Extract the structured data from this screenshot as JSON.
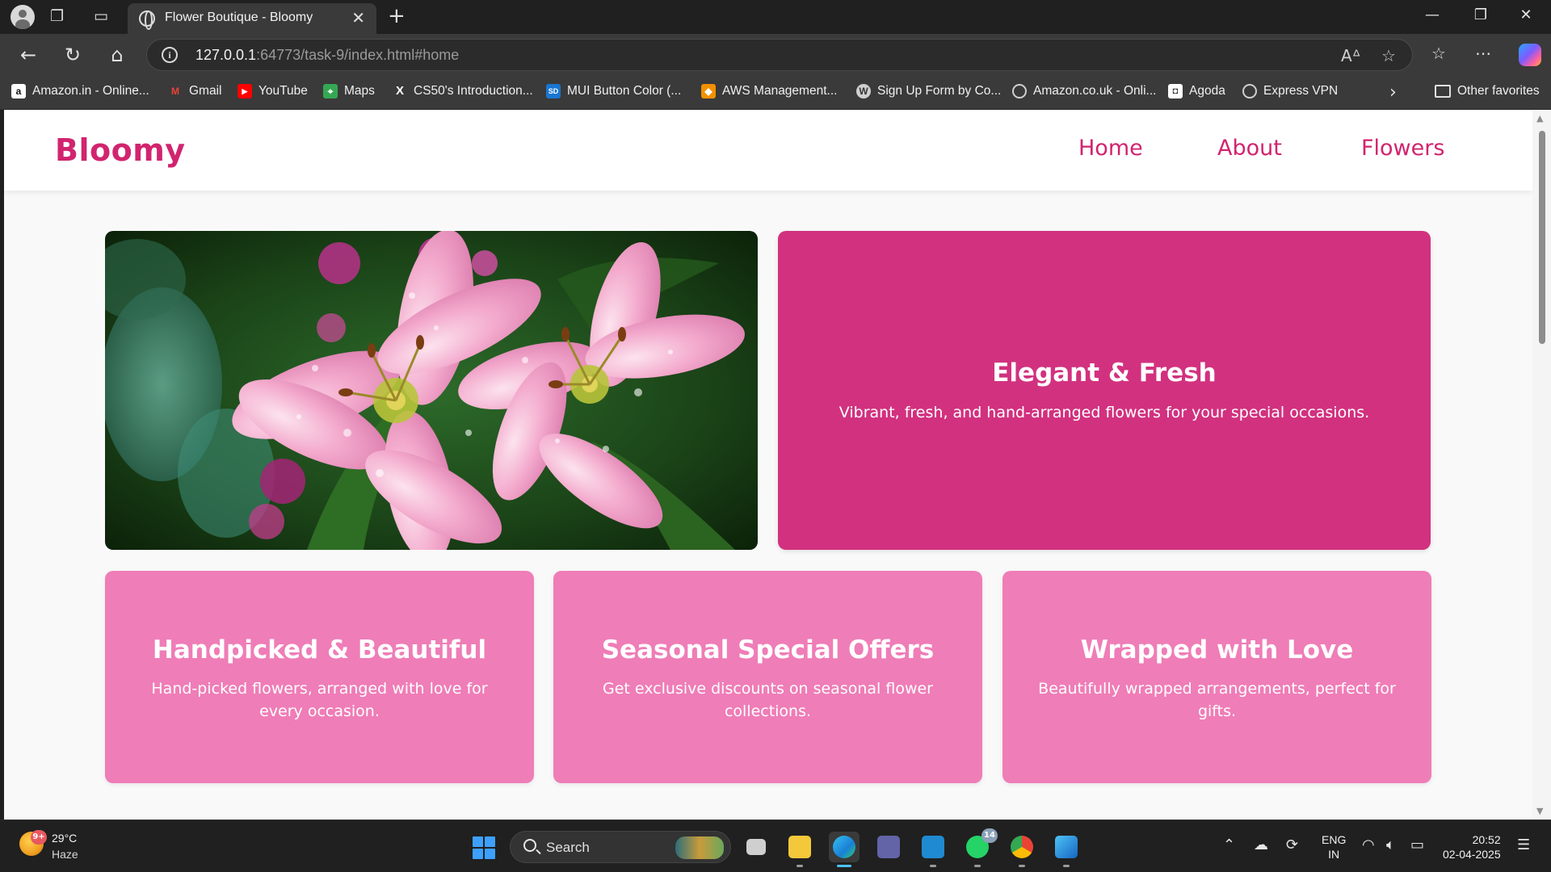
{
  "browser": {
    "tab_title": "Flower Boutique - Bloomy",
    "url_host": "127.0.0.1",
    "url_rest": ":64773/task-9/index.html#home",
    "favorites": [
      {
        "label": "Amazon.in - Online...",
        "icon": "amazon-icon",
        "color": "#ffffff"
      },
      {
        "label": "Gmail",
        "icon": "gmail-icon",
        "color": "#ea4335"
      },
      {
        "label": "YouTube",
        "icon": "youtube-icon",
        "color": "#ff0000"
      },
      {
        "label": "Maps",
        "icon": "maps-icon",
        "color": "#34a853"
      },
      {
        "label": "CS50's Introduction...",
        "icon": "x-icon",
        "color": "#ffffff"
      },
      {
        "label": "MUI Button Color (...",
        "icon": "sd-icon",
        "color": "#1976d2"
      },
      {
        "label": "AWS Management...",
        "icon": "aws-icon",
        "color": "#f29100"
      },
      {
        "label": "Sign Up Form by Co...",
        "icon": "wordpress-icon",
        "color": "#d0d0d0"
      },
      {
        "label": "Amazon.co.uk - Onli...",
        "icon": "globe-icon",
        "color": "#d0d0d0"
      },
      {
        "label": "Agoda",
        "icon": "agoda-icon",
        "color": "#ffffff"
      },
      {
        "label": "Express VPN",
        "icon": "globe-icon",
        "color": "#d0d0d0"
      }
    ],
    "other_favorites": "Other favorites"
  },
  "site": {
    "logo": "Bloomy",
    "nav": [
      "Home",
      "About",
      "Flowers"
    ],
    "accent_color": "#d1246f",
    "hero_image": {
      "icon": "pink-lily-flowers-photo"
    },
    "hero_card": {
      "title": "Elegant & Fresh",
      "text": "Vibrant, fresh, and hand-arranged flowers for your special occasions.",
      "color": "#d2317f"
    },
    "cards": [
      {
        "title": "Handpicked & Beautiful",
        "text": "Hand-picked flowers, arranged with love for every occasion."
      },
      {
        "title": "Seasonal Special Offers",
        "text": "Get exclusive discounts on seasonal flower collections."
      },
      {
        "title": "Wrapped with Love",
        "text": "Beautifully wrapped arrangements, perfect for gifts."
      }
    ],
    "card_color": "#ef7db7"
  },
  "taskbar": {
    "weather_badge": "9+",
    "temperature": "29°C",
    "condition": "Haze",
    "search_label": "Search",
    "whatsapp_badge": "14",
    "lang_line1": "ENG",
    "lang_line2": "IN",
    "time": "20:52",
    "date": "02-04-2025"
  }
}
